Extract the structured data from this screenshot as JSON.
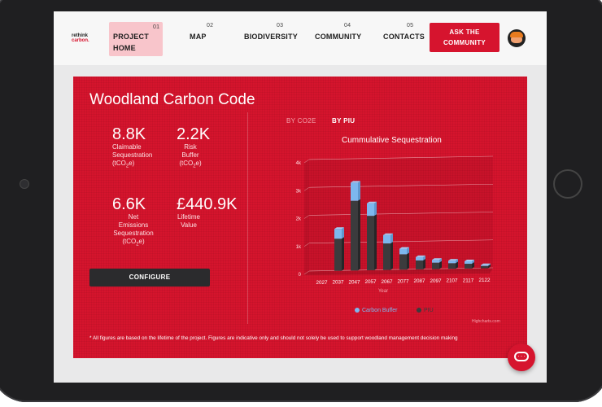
{
  "logo": {
    "line1": "rethink",
    "line2": "carbon."
  },
  "nav": {
    "items": [
      {
        "num": "01",
        "label1": "PROJECT",
        "label2": "HOME",
        "active": true
      },
      {
        "num": "02",
        "label1": "MAP",
        "label2": ""
      },
      {
        "num": "03",
        "label1": "BIODIVERSITY",
        "label2": ""
      },
      {
        "num": "04",
        "label1": "COMMUNITY",
        "label2": ""
      },
      {
        "num": "05",
        "label1": "CONTACTS",
        "label2": ""
      }
    ],
    "ask_line1": "ASK THE",
    "ask_line2": "COMMUNITY"
  },
  "panel": {
    "title": "Woodland Carbon Code",
    "stats": [
      {
        "value": "8.8K",
        "l1": "Claimable",
        "l2": "Sequestration",
        "l3": "(tCO",
        "sub": "2",
        "l3b": "e)"
      },
      {
        "value": "2.2K",
        "l1": "Risk",
        "l2": "Buffer",
        "l3": "(tCO",
        "sub": "2",
        "l3b": "e)"
      },
      {
        "value": "6.6K",
        "l1": "Net",
        "l2": "Emissions",
        "l3": "Sequestration",
        "l4": "(tCO",
        "sub": "2",
        "l4b": "e)"
      },
      {
        "value": "£440.9K",
        "l1": "Lifetime",
        "l2": "Value"
      }
    ],
    "configure": "CONFIGURE",
    "tabs": [
      "BY CO2E",
      "BY PIU"
    ],
    "footnote": "* All figures are based on the lifetime of the project. Figures are indicative only and should not solely be used to support woodland management decision making",
    "credits": "Highcharts.com"
  },
  "chart_data": {
    "type": "bar",
    "title": "Cummulative Sequestration",
    "xlabel": "Year",
    "categories": [
      "2027",
      "2037",
      "2047",
      "2057",
      "2067",
      "2077",
      "2087",
      "2097",
      "2107",
      "2117",
      "2122"
    ],
    "y_ticks": [
      "0",
      "1k",
      "2k",
      "3k",
      "4k"
    ],
    "ylim": [
      0,
      4000
    ],
    "stacked": true,
    "series": [
      {
        "name": "Carbon Buffer",
        "color": "#7db7ee",
        "values": [
          0,
          350,
          650,
          450,
          300,
          200,
          120,
          100,
          90,
          90,
          30
        ]
      },
      {
        "name": "PIU",
        "color": "#3b3b3d",
        "values": [
          0,
          1150,
          2500,
          1950,
          950,
          550,
          320,
          230,
          200,
          170,
          80
        ]
      }
    ],
    "legend_position": "bottom"
  },
  "colors": {
    "brand": "#d6142e",
    "panel": "#d5142d",
    "buffer": "#7db7ee",
    "piu": "#3b3b3d"
  },
  "icons": {
    "chat": "chat-bubble-icon",
    "avatar": "user-avatar"
  }
}
